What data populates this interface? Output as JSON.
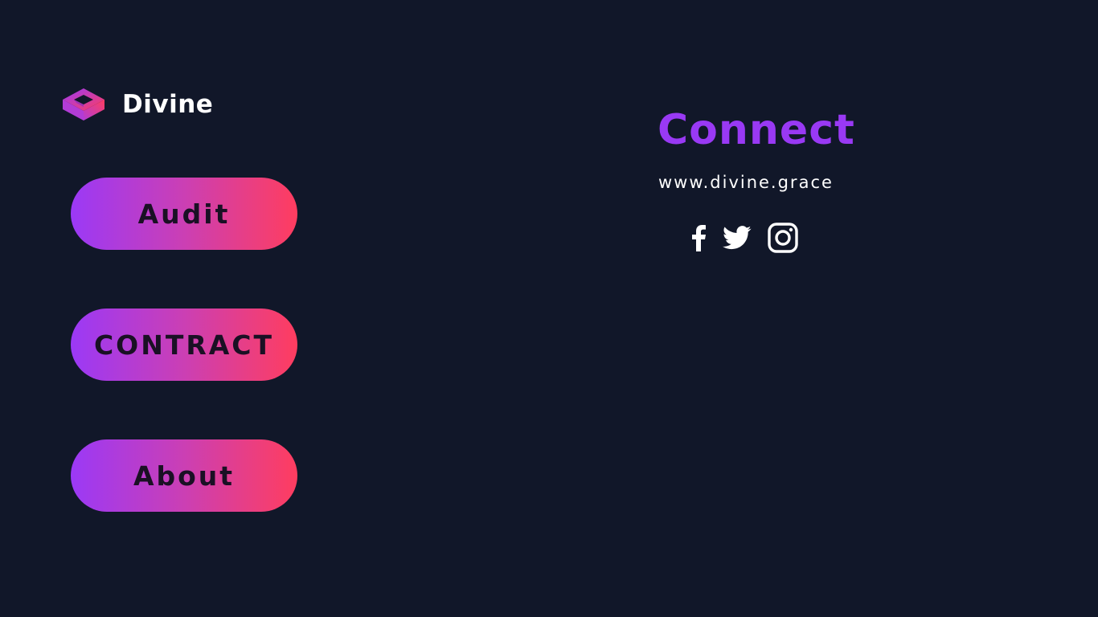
{
  "brand": {
    "name": "Divine",
    "logo_icon": "isometric-cube-frame-icon",
    "colors": {
      "primary": "#9b39f6",
      "secondary": "#ff3d5f"
    }
  },
  "nav": {
    "items": [
      {
        "label": "Audit"
      },
      {
        "label": "CONTRACT"
      },
      {
        "label": "About"
      }
    ],
    "gradient": [
      "#9b39f6",
      "#cb3fb4",
      "#ff3d5f"
    ]
  },
  "connect": {
    "title": "Connect",
    "title_color": "#9939f4",
    "website": "www.divine.grace",
    "social": [
      {
        "icon": "facebook-icon"
      },
      {
        "icon": "twitter-icon"
      },
      {
        "icon": "instagram-icon"
      }
    ]
  },
  "theme": {
    "background": "#111729",
    "text": "#ffffff"
  }
}
